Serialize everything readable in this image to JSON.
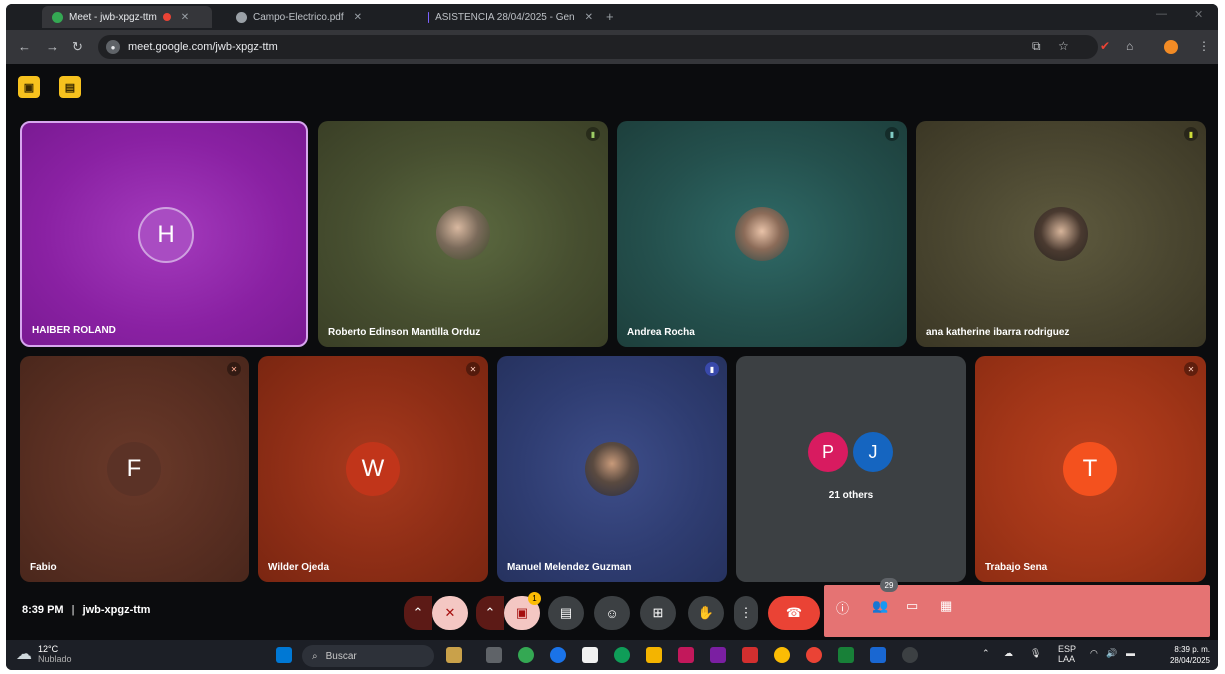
{
  "browser": {
    "tabs": [
      {
        "label": "Meet - jwb-xpgz-ttm",
        "active": true
      },
      {
        "label": "Campo-Electrico.pdf",
        "active": false
      },
      {
        "label": "ASISTENCIA 28/04/2025 - Gen",
        "active": false
      }
    ],
    "url": "meet.google.com/jwb-xpgz-ttm"
  },
  "meet": {
    "participants": [
      {
        "name": "HAIBER ROLAND",
        "initial": "H",
        "color": "#8e24aa"
      },
      {
        "name": "Roberto Edinson Mantilla Orduz"
      },
      {
        "name": "Andrea Rocha"
      },
      {
        "name": "ana katherine ibarra rodriguez"
      },
      {
        "name": "Fabio",
        "initial": "F"
      },
      {
        "name": "Wilder Ojeda",
        "initial": "W"
      },
      {
        "name": "Manuel Melendez Guzman"
      },
      {
        "name": "21 others",
        "initials": [
          "P",
          "J"
        ]
      },
      {
        "name": "Trabajo Sena",
        "initial": "T"
      }
    ],
    "time": "8:39 PM",
    "separator": "|",
    "meeting_code": "jwb-xpgz-ttm",
    "participant_count": "29",
    "reaction_badge": "1"
  },
  "taskbar": {
    "temperature": "12°C",
    "condition": "Nublado",
    "search_placeholder": "Buscar",
    "lang_top": "ESP",
    "lang_bottom": "LAA",
    "clock_time": "8:39 p. m.",
    "clock_date": "28/04/2025"
  },
  "colors": {
    "accent_yellow": "#f7c21e",
    "end_call_red": "#ea4335",
    "panel_pink": "#e57373"
  }
}
